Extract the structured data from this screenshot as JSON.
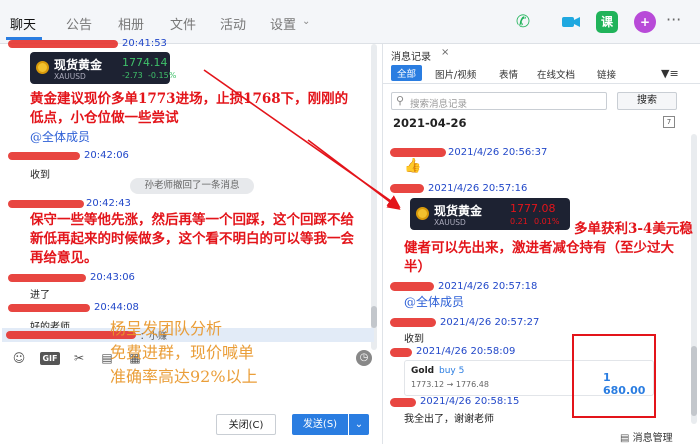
{
  "tabs": {
    "chat": "聊天",
    "announce": "公告",
    "album": "相册",
    "files": "文件",
    "activity": "活动",
    "settings": "设置"
  },
  "chat": {
    "ts1": "20:41:53",
    "gold_name": "现货黄金",
    "gold_symbol": "XAUUSD",
    "gold_price1": "1774.14",
    "gold_change1": "-2.73",
    "gold_pct1": "-0.15%",
    "annotation1": "黄金建议现价多单1773进场，止损1768下，刚刚的低点，小仓位做一些尝试",
    "mention": "@全体成员",
    "ts2": "20:42:06",
    "msg_received": "收到",
    "recall_notice": "孙老师撤回了一条消息",
    "ts3": "20:42:43",
    "annotation2": "保守一些等他先涨，然后再等一个回踩，这个回踩不给新低再起来的时候做多，这个看不明白的可以等我一会再给意见。",
    "ts4": "20:43:06",
    "msg_in": "进了",
    "ts5": "20:44:08",
    "msg_good_teacher": "好的老师",
    "quote_snippet": "：小赚",
    "overlay_lines": [
      "杨呈发团队分析",
      "免费进群，现价喊单",
      "准确率高达92%以上"
    ],
    "close_btn": "关闭(C)",
    "send_btn": "发送(S)"
  },
  "history": {
    "title": "消息记录",
    "close": "×",
    "tabs": [
      "全部",
      "图片/视频",
      "表情",
      "在线文档",
      "链接"
    ],
    "search_placeholder": "搜索消息记录",
    "search_btn": "搜索",
    "date": "2021-04-26",
    "ts_a": "2021/4/26 20:56:37",
    "ts_b": "2021/4/26 20:57:16",
    "gold_price2": "1777.08",
    "gold_change2": "0.21",
    "gold_pct2": "0.01%",
    "annotation3": "多单获利3-4美元稳健者可以先出来，激进者减仓持有（至少过大半）",
    "ts_c": "2021/4/26 20:57:18",
    "mention": "@全体成员",
    "ts_d": "2021/4/26 20:57:27",
    "msg_received": "收到",
    "ts_e": "2021/4/26 20:58:09",
    "trade_title": "Gold",
    "trade_side": "buy 5",
    "trade_prices": "1773.12 → 1776.48",
    "trade_profit": "1 680.00",
    "ts_f": "2021/4/26 20:58:15",
    "msg_thanks": "我全出了，谢谢老师",
    "footer": "消息管理"
  },
  "colors": {
    "accent": "#2a7de1",
    "annotation": "#e3141a",
    "timestamp": "#2248c9",
    "gold_up": "#e3141a",
    "gold_down": "#3fc16a"
  }
}
